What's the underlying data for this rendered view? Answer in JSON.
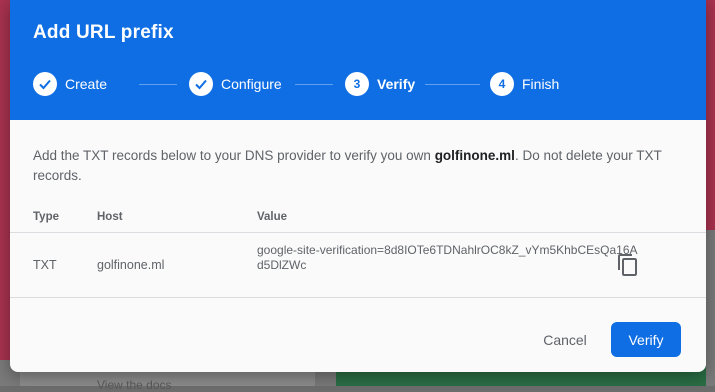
{
  "dialog": {
    "title": "Add URL prefix"
  },
  "stepper": {
    "steps": [
      {
        "number": "",
        "label": "Create",
        "state": "complete"
      },
      {
        "number": "",
        "label": "Configure",
        "state": "complete"
      },
      {
        "number": "3",
        "label": "Verify",
        "state": "active"
      },
      {
        "number": "4",
        "label": "Finish",
        "state": "pending"
      }
    ]
  },
  "description": {
    "prefix": "Add the TXT records below to your DNS provider to verify you own ",
    "domain": "golfinone.ml",
    "suffix": ". Do not delete your TXT records."
  },
  "table": {
    "headers": {
      "type": "Type",
      "host": "Host",
      "value": "Value"
    },
    "rows": [
      {
        "type": "TXT",
        "host": "golfinone.ml",
        "value": "google-site-verification=8d8IOTe6TDNahlrOC8kZ_vYm5KhbCEsQa16Ad5DlZWc"
      }
    ]
  },
  "footer": {
    "cancel_label": "Cancel",
    "verify_label": "Verify"
  },
  "background": {
    "partial_text": "View the docs"
  },
  "colors": {
    "header": "#0f6ee3",
    "primary_button": "#0f6ee3"
  },
  "icons": {
    "complete_step": "check-icon",
    "copy": "copy-icon"
  }
}
